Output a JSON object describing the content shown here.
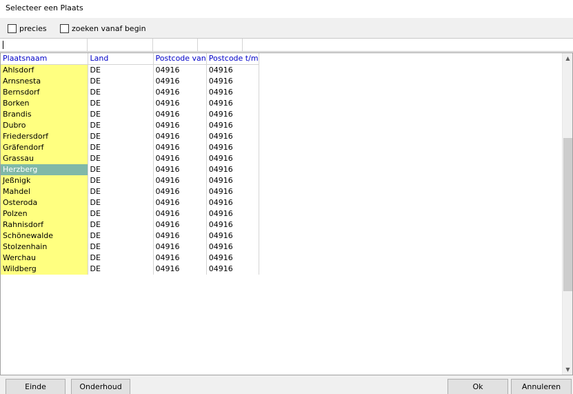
{
  "window": {
    "title": "Selecteer een Plaats"
  },
  "options": {
    "precies_label": "precies",
    "zoeken_label": "zoeken vanaf begin"
  },
  "grid": {
    "columns": [
      "Plaatsnaam",
      "Land",
      "Postcode van",
      "Postcode t/m"
    ],
    "rows": [
      [
        "Ahlsdorf",
        "DE",
        "04916",
        "04916"
      ],
      [
        "Arnsnesta",
        "DE",
        "04916",
        "04916"
      ],
      [
        "Bernsdorf",
        "DE",
        "04916",
        "04916"
      ],
      [
        "Borken",
        "DE",
        "04916",
        "04916"
      ],
      [
        "Brandis",
        "DE",
        "04916",
        "04916"
      ],
      [
        "Dubro",
        "DE",
        "04916",
        "04916"
      ],
      [
        "Friedersdorf",
        "DE",
        "04916",
        "04916"
      ],
      [
        "Gräfendorf",
        "DE",
        "04916",
        "04916"
      ],
      [
        "Grassau",
        "DE",
        "04916",
        "04916"
      ],
      [
        "Herzberg",
        "DE",
        "04916",
        "04916"
      ],
      [
        "Jeßnigk",
        "DE",
        "04916",
        "04916"
      ],
      [
        "Mahdel",
        "DE",
        "04916",
        "04916"
      ],
      [
        "Osteroda",
        "DE",
        "04916",
        "04916"
      ],
      [
        "Polzen",
        "DE",
        "04916",
        "04916"
      ],
      [
        "Rahnisdorf",
        "DE",
        "04916",
        "04916"
      ],
      [
        "Schönewalde",
        "DE",
        "04916",
        "04916"
      ],
      [
        "Stolzenhain",
        "DE",
        "04916",
        "04916"
      ],
      [
        "Werchau",
        "DE",
        "04916",
        "04916"
      ],
      [
        "Wildberg",
        "DE",
        "04916",
        "04916"
      ]
    ],
    "selected_row": 9
  },
  "buttons": {
    "einde": "Einde",
    "onderhoud": "Onderhoud",
    "ok": "Ok",
    "annuleren": "Annuleren"
  },
  "scrollbar": {
    "up_icon": "▲",
    "down_icon": "▼"
  },
  "colors": {
    "name_cell_bg": "#ffff80",
    "selected_bg": "#80b8a8",
    "header_text": "#0000c8"
  }
}
